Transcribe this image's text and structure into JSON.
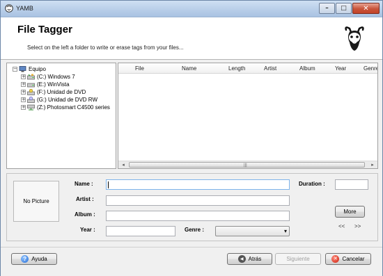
{
  "window": {
    "title": "YAMB",
    "app_icon": "gnu-icon",
    "controls": {
      "minimize": "minimize-icon",
      "maximize": "maximize-icon",
      "close": "close-icon"
    }
  },
  "header": {
    "title": "File Tagger",
    "subtitle": "Select on the left a folder to write or erase tags from your files...",
    "logo": "gnu-logo-icon"
  },
  "tree": {
    "root": {
      "label": "Equipo",
      "icon": "computer-icon"
    },
    "items": [
      {
        "label": "(C:) Windows 7",
        "icon": "drive-icon"
      },
      {
        "label": "(E:) WinVista",
        "icon": "drive-icon"
      },
      {
        "label": "(F:) Unidad de DVD",
        "icon": "dvd-drive-icon"
      },
      {
        "label": "(G:) Unidad de DVD RW",
        "icon": "dvd-rw-drive-icon"
      },
      {
        "label": "(Z:) Photosmart C4500 series",
        "icon": "network-drive-icon"
      }
    ]
  },
  "file_list": {
    "columns": [
      "File",
      "Name",
      "Length",
      "Artist",
      "Album",
      "Year",
      "Genre"
    ],
    "rows": []
  },
  "tags": {
    "picture_placeholder": "No Picture",
    "name_label": "Name :",
    "name_value": "",
    "artist_label": "Artist :",
    "artist_value": "",
    "album_label": "Album :",
    "album_value": "",
    "year_label": "Year :",
    "year_value": "",
    "genre_label": "Genre :",
    "genre_value": "",
    "duration_label": "Duration :",
    "duration_value": "",
    "more_button": "More",
    "prev_arrows": "<<",
    "next_arrows": ">>"
  },
  "footer": {
    "help_button": {
      "label": "Ayuda",
      "icon": "help-icon"
    },
    "back_button": {
      "label": "Atrás",
      "icon": "back-arrow-icon"
    },
    "next_button": {
      "label": "Siguiente",
      "enabled": false
    },
    "cancel_button": {
      "label": "Cancelar",
      "icon": "cancel-icon"
    }
  },
  "colors": {
    "titlebar": "#b7cde8",
    "close_button": "#c8543a",
    "window_bg": "#f0f0f0",
    "focus_border": "#7eb4ea"
  }
}
